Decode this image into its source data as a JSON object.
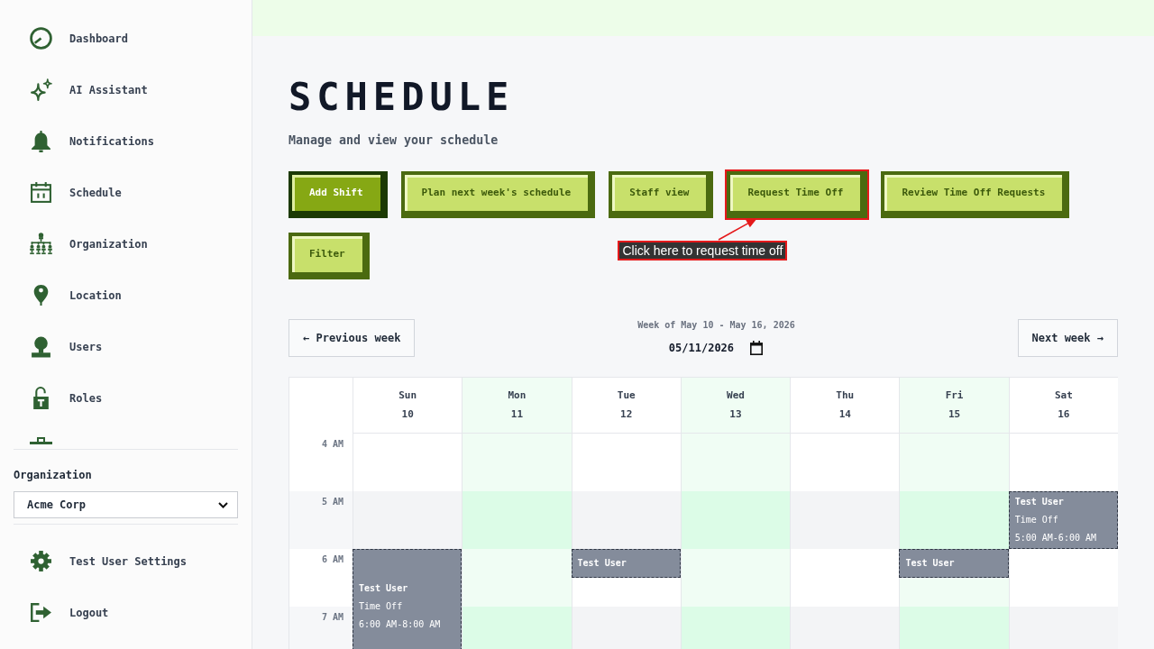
{
  "sidebar": {
    "nav_items": [
      {
        "label": "Dashboard"
      },
      {
        "label": "AI Assistant"
      },
      {
        "label": "Notifications"
      },
      {
        "label": "Schedule"
      },
      {
        "label": "Organization"
      },
      {
        "label": "Location"
      },
      {
        "label": "Users"
      },
      {
        "label": "Roles"
      }
    ],
    "organization": {
      "label": "Organization",
      "value": "Acme Corp"
    },
    "footer_items": [
      {
        "label": "Test User Settings"
      },
      {
        "label": "Logout"
      }
    ]
  },
  "page": {
    "title": "SCHEDULE",
    "subtitle": "Manage and view your schedule"
  },
  "actions": [
    {
      "label": "Add Shift",
      "kind": "primary",
      "highlighted": false
    },
    {
      "label": "Plan next week's schedule",
      "kind": "secondary",
      "highlighted": false
    },
    {
      "label": "Staff view",
      "kind": "secondary",
      "highlighted": false
    },
    {
      "label": "Request Time Off",
      "kind": "secondary",
      "highlighted": true,
      "callout": "Click here to request time off"
    },
    {
      "label": "Review Time Off Requests",
      "kind": "secondary",
      "highlighted": false
    },
    {
      "label": "Filter",
      "kind": "secondary",
      "highlighted": false
    }
  ],
  "week_nav": {
    "previous": "← Previous week",
    "range": "Week of May 10 - May 16, 2026",
    "date": "05/11/2026",
    "next": "Next week →"
  },
  "calendar": {
    "hours": [
      {
        "label": "4 AM"
      },
      {
        "label": "5 AM"
      },
      {
        "label": "6 AM"
      },
      {
        "label": "7 AM"
      }
    ],
    "days": [
      {
        "name": "Sun",
        "date": "10",
        "events": [
          {
            "kind": "from6_2h",
            "person": "Test User",
            "type": "Time Off",
            "time": "6:00 AM-8:00 AM"
          }
        ]
      },
      {
        "name": "Mon",
        "date": "11"
      },
      {
        "name": "Tue",
        "date": "12",
        "events": [
          {
            "kind": "from6_30m",
            "person": "Test User"
          }
        ]
      },
      {
        "name": "Wed",
        "date": "13"
      },
      {
        "name": "Thu",
        "date": "14"
      },
      {
        "name": "Fri",
        "date": "15",
        "events": [
          {
            "kind": "from6_30m",
            "person": "Test User"
          }
        ]
      },
      {
        "name": "Sat",
        "date": "16",
        "events": [
          {
            "kind": "from5_1h",
            "person": "Test User",
            "type": "Time Off",
            "time": "5:00 AM-6:00 AM"
          }
        ]
      }
    ]
  }
}
